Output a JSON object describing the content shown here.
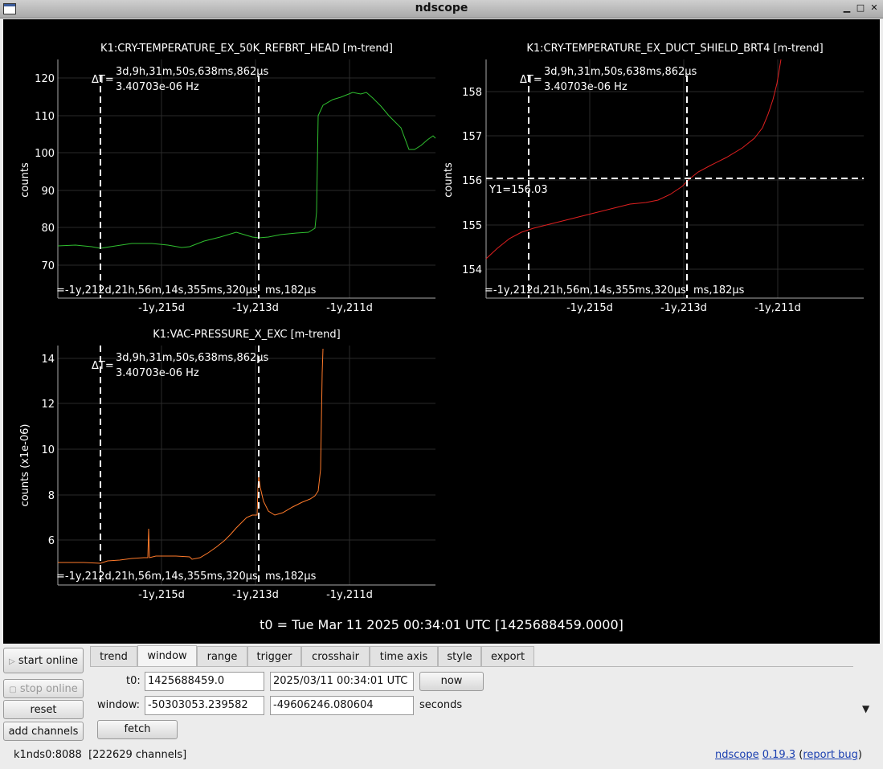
{
  "window": {
    "title": "ndscope"
  },
  "plots": [
    {
      "title": "K1:CRY-TEMPERATURE_EX_50K_REFBRT_HEAD [m-trend]",
      "ylabel": "counts",
      "yticks": [
        "70",
        "80",
        "90",
        "100",
        "110",
        "120"
      ],
      "xticks": [
        "-1y,215d",
        "-1y,213d",
        "-1y,211d"
      ],
      "cursor_dt": "ΔT=",
      "cursor_dt_value": "3d,9h,31m,50s,638ms,862µs",
      "cursor_freq": "3.40703e-06 Hz",
      "cursor_t": "=-1y,212d,21h,56m,14s,355ms,320µs",
      "cursor_t2": "ms,182µs",
      "color": "#2fbf2f"
    },
    {
      "title": "K1:CRY-TEMPERATURE_EX_DUCT_SHIELD_BRT4 [m-trend]",
      "ylabel": "counts",
      "yticks": [
        "154",
        "155",
        "156",
        "157",
        "158"
      ],
      "xticks": [
        "-1y,215d",
        "-1y,213d",
        "-1y,211d"
      ],
      "cursor_dt": "ΔT=",
      "cursor_dt_value": "3d,9h,31m,50s,638ms,862µs",
      "cursor_freq": "3.40703e-06 Hz",
      "cursor_t": "=-1y,212d,21h,56m,14s,355ms,320µs",
      "cursor_t2": "ms,182µs",
      "y_cursor": "Y1=156.03",
      "color": "#e02020"
    },
    {
      "title": "K1:VAC-PRESSURE_X_EXC [m-trend]",
      "ylabel": "counts (x1e-06)",
      "yticks": [
        "6",
        "8",
        "10",
        "12",
        "14"
      ],
      "xticks": [
        "-1y,215d",
        "-1y,213d",
        "-1y,211d"
      ],
      "cursor_dt": "ΔT=",
      "cursor_dt_value": "3d,9h,31m,50s,638ms,862µs",
      "cursor_freq": "3.40703e-06 Hz",
      "cursor_t": "=-1y,212d,21h,56m,14s,355ms,320µs",
      "cursor_t2": "ms,182µs",
      "color": "#ff7a2a"
    }
  ],
  "t0_banner": "t0 = Tue Mar 11 2025 00:34:01 UTC [1425688459.0000]",
  "controls": {
    "start_online": "start online",
    "stop_online": "stop online",
    "reset": "reset",
    "add_channels": "add channels",
    "tabs": [
      "trend",
      "window",
      "range",
      "trigger",
      "crosshair",
      "time axis",
      "style",
      "export"
    ],
    "active_tab": "window",
    "t0_label": "t0:",
    "t0_gps": "1425688459.0",
    "t0_utc": "2025/03/11 00:34:01 UTC",
    "now": "now",
    "window_label": "window:",
    "window_start": "-50303053.239582",
    "window_end": "-49606246.080604",
    "seconds": "seconds",
    "fetch": "fetch"
  },
  "status": {
    "server": "k1nds0:8088",
    "channels": "[222629 channels]",
    "app_link": "ndscope",
    "version": "0.19.3",
    "open_paren": "(",
    "report_bug": "report bug",
    "close_paren": ")"
  }
}
